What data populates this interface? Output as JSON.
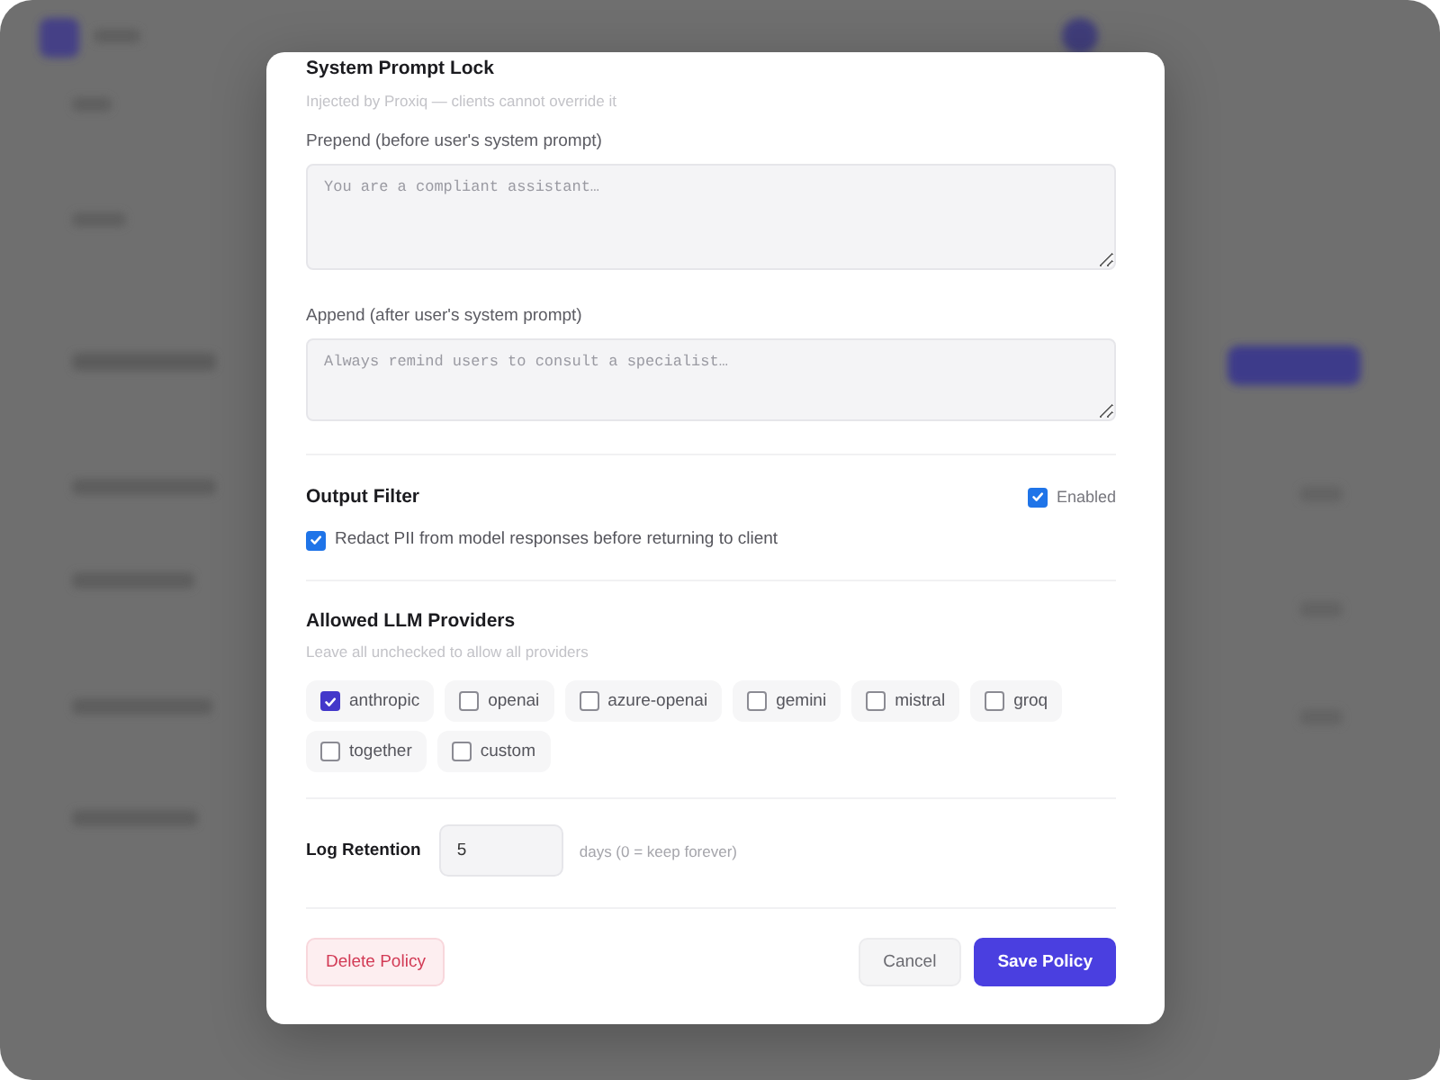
{
  "system_prompt_lock": {
    "title": "System Prompt Lock",
    "subtitle": "Injected by Proxiq — clients cannot override it",
    "fields": [
      {
        "label": "Prepend (before user's system prompt)",
        "placeholder": "You are a compliant assistant…"
      },
      {
        "label": "Append (after user's system prompt)",
        "placeholder": "Always remind users to consult a specialist…"
      }
    ]
  },
  "output_filter": {
    "title": "Output Filter",
    "enabled": {
      "label": "Enabled",
      "checked": true
    },
    "option": {
      "label": "Redact PII from model responses before returning to client",
      "checked": true
    }
  },
  "providers": {
    "title": "Allowed LLM Providers",
    "hint": "Leave all unchecked to allow all providers",
    "items": [
      {
        "label": "anthropic",
        "checked": true
      },
      {
        "label": "openai",
        "checked": false
      },
      {
        "label": "azure-openai",
        "checked": false
      },
      {
        "label": "gemini",
        "checked": false
      },
      {
        "label": "mistral",
        "checked": false
      },
      {
        "label": "groq",
        "checked": false
      },
      {
        "label": "together",
        "checked": false
      },
      {
        "label": "custom",
        "checked": false
      }
    ]
  },
  "log_retention": {
    "label": "Log Retention",
    "value": "5",
    "unit": "days (0 = keep forever)"
  },
  "footer": {
    "buttons": [
      {
        "label": "Delete Policy",
        "kind": "danger"
      },
      {
        "label": "Cancel",
        "kind": "secondary"
      },
      {
        "label": "Save Policy",
        "kind": "primary"
      }
    ]
  }
}
